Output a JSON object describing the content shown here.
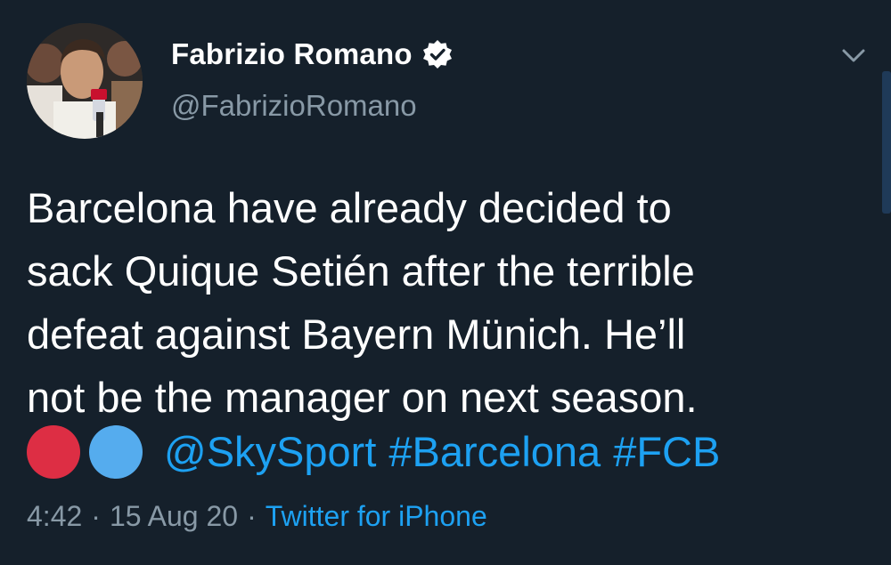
{
  "author": {
    "display_name": "Fabrizio Romano",
    "handle": "@FabrizioRomano",
    "verified": true
  },
  "tweet": {
    "lines": [
      "Barcelona have already decided to",
      "sack Quique Setién after the terrible",
      "defeat against Bayern Münich. He’ll",
      "not be the manager on next season."
    ],
    "emoji": [
      "red-circle-icon",
      "blue-circle-icon"
    ],
    "links": [
      "@SkySport",
      "#Barcelona",
      "#FCB"
    ]
  },
  "meta": {
    "time": "4:42",
    "separator": "·",
    "date": "15 Aug 20",
    "source": "Twitter for iPhone"
  },
  "colors": {
    "background": "#15202b",
    "text": "#ffffff",
    "muted": "#8899a6",
    "link": "#1da1f2",
    "red_circle": "#dd2e44",
    "blue_circle": "#55acee"
  }
}
